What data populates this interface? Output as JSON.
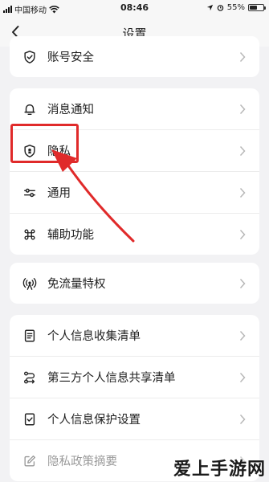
{
  "status_bar": {
    "carrier": "中国移动",
    "time": "08:46",
    "battery": "55%",
    "battery_level": 0.55
  },
  "nav": {
    "title": "设置"
  },
  "groups": [
    {
      "items": [
        {
          "label": "账号安全",
          "icon": "shield-check-icon"
        }
      ]
    },
    {
      "items": [
        {
          "label": "消息通知",
          "icon": "bell-icon"
        },
        {
          "label": "隐私",
          "icon": "privacy-shield-icon"
        },
        {
          "label": "通用",
          "icon": "sliders-icon"
        },
        {
          "label": "辅助功能",
          "icon": "command-icon"
        }
      ]
    },
    {
      "items": [
        {
          "label": "免流量特权",
          "icon": "broadcast-icon"
        }
      ]
    },
    {
      "items": [
        {
          "label": "个人信息收集清单",
          "icon": "document-list-icon"
        },
        {
          "label": "第三方个人信息共享清单",
          "icon": "share-flow-icon"
        },
        {
          "label": "个人信息保护设置",
          "icon": "protected-file-icon"
        },
        {
          "label": "隐私政策摘要",
          "icon": "edit-icon"
        }
      ]
    }
  ],
  "watermark": "爱上手游网",
  "colors": {
    "annotation": "#e02a2a",
    "background": "#f2f2f4"
  }
}
